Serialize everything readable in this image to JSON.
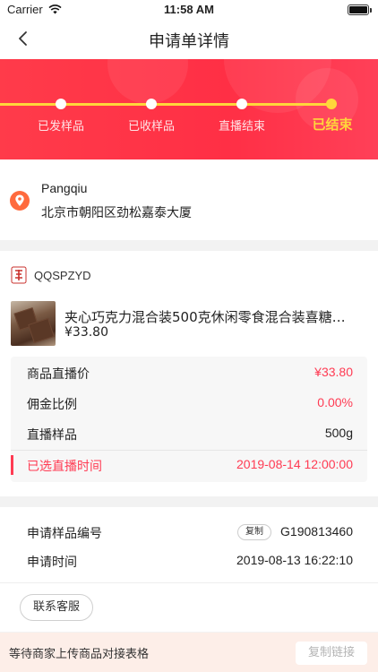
{
  "status_bar": {
    "carrier": "Carrier",
    "time": "11:58 AM"
  },
  "nav": {
    "title": "申请单详情"
  },
  "progress": {
    "steps": [
      "已发样品",
      "已收样品",
      "直播结束",
      "已结束"
    ],
    "current_index": 3,
    "track_color": "#ffd63b",
    "background": "#ff3b4a"
  },
  "address": {
    "name": "Pangqiu",
    "detail": "北京市朝阳区劲松嘉泰大厦"
  },
  "shop": {
    "name": "QQSPZYD"
  },
  "product": {
    "title": "夹心巧克力混合装500克休闲零食混合装喜糖家…",
    "price": "¥33.80"
  },
  "details": [
    {
      "label": "商品直播价",
      "value": "¥33.80"
    },
    {
      "label": "佣金比例",
      "value": "0.00%"
    },
    {
      "label": "直播样品",
      "value": "500g"
    },
    {
      "label": "已选直播时间",
      "value": "2019-08-14 12:00:00"
    }
  ],
  "application": {
    "number_label": "申请样品编号",
    "copy_label": "复制",
    "number": "G190813460",
    "time_label": "申请时间",
    "time": "2019-08-13 16:22:10"
  },
  "service": {
    "label": "联系客服"
  },
  "bottom": {
    "message": "等待商家上传商品对接表格",
    "button": "复制链接"
  },
  "colors": {
    "accent": "#ff3b53",
    "highlight": "#ffd63b"
  }
}
